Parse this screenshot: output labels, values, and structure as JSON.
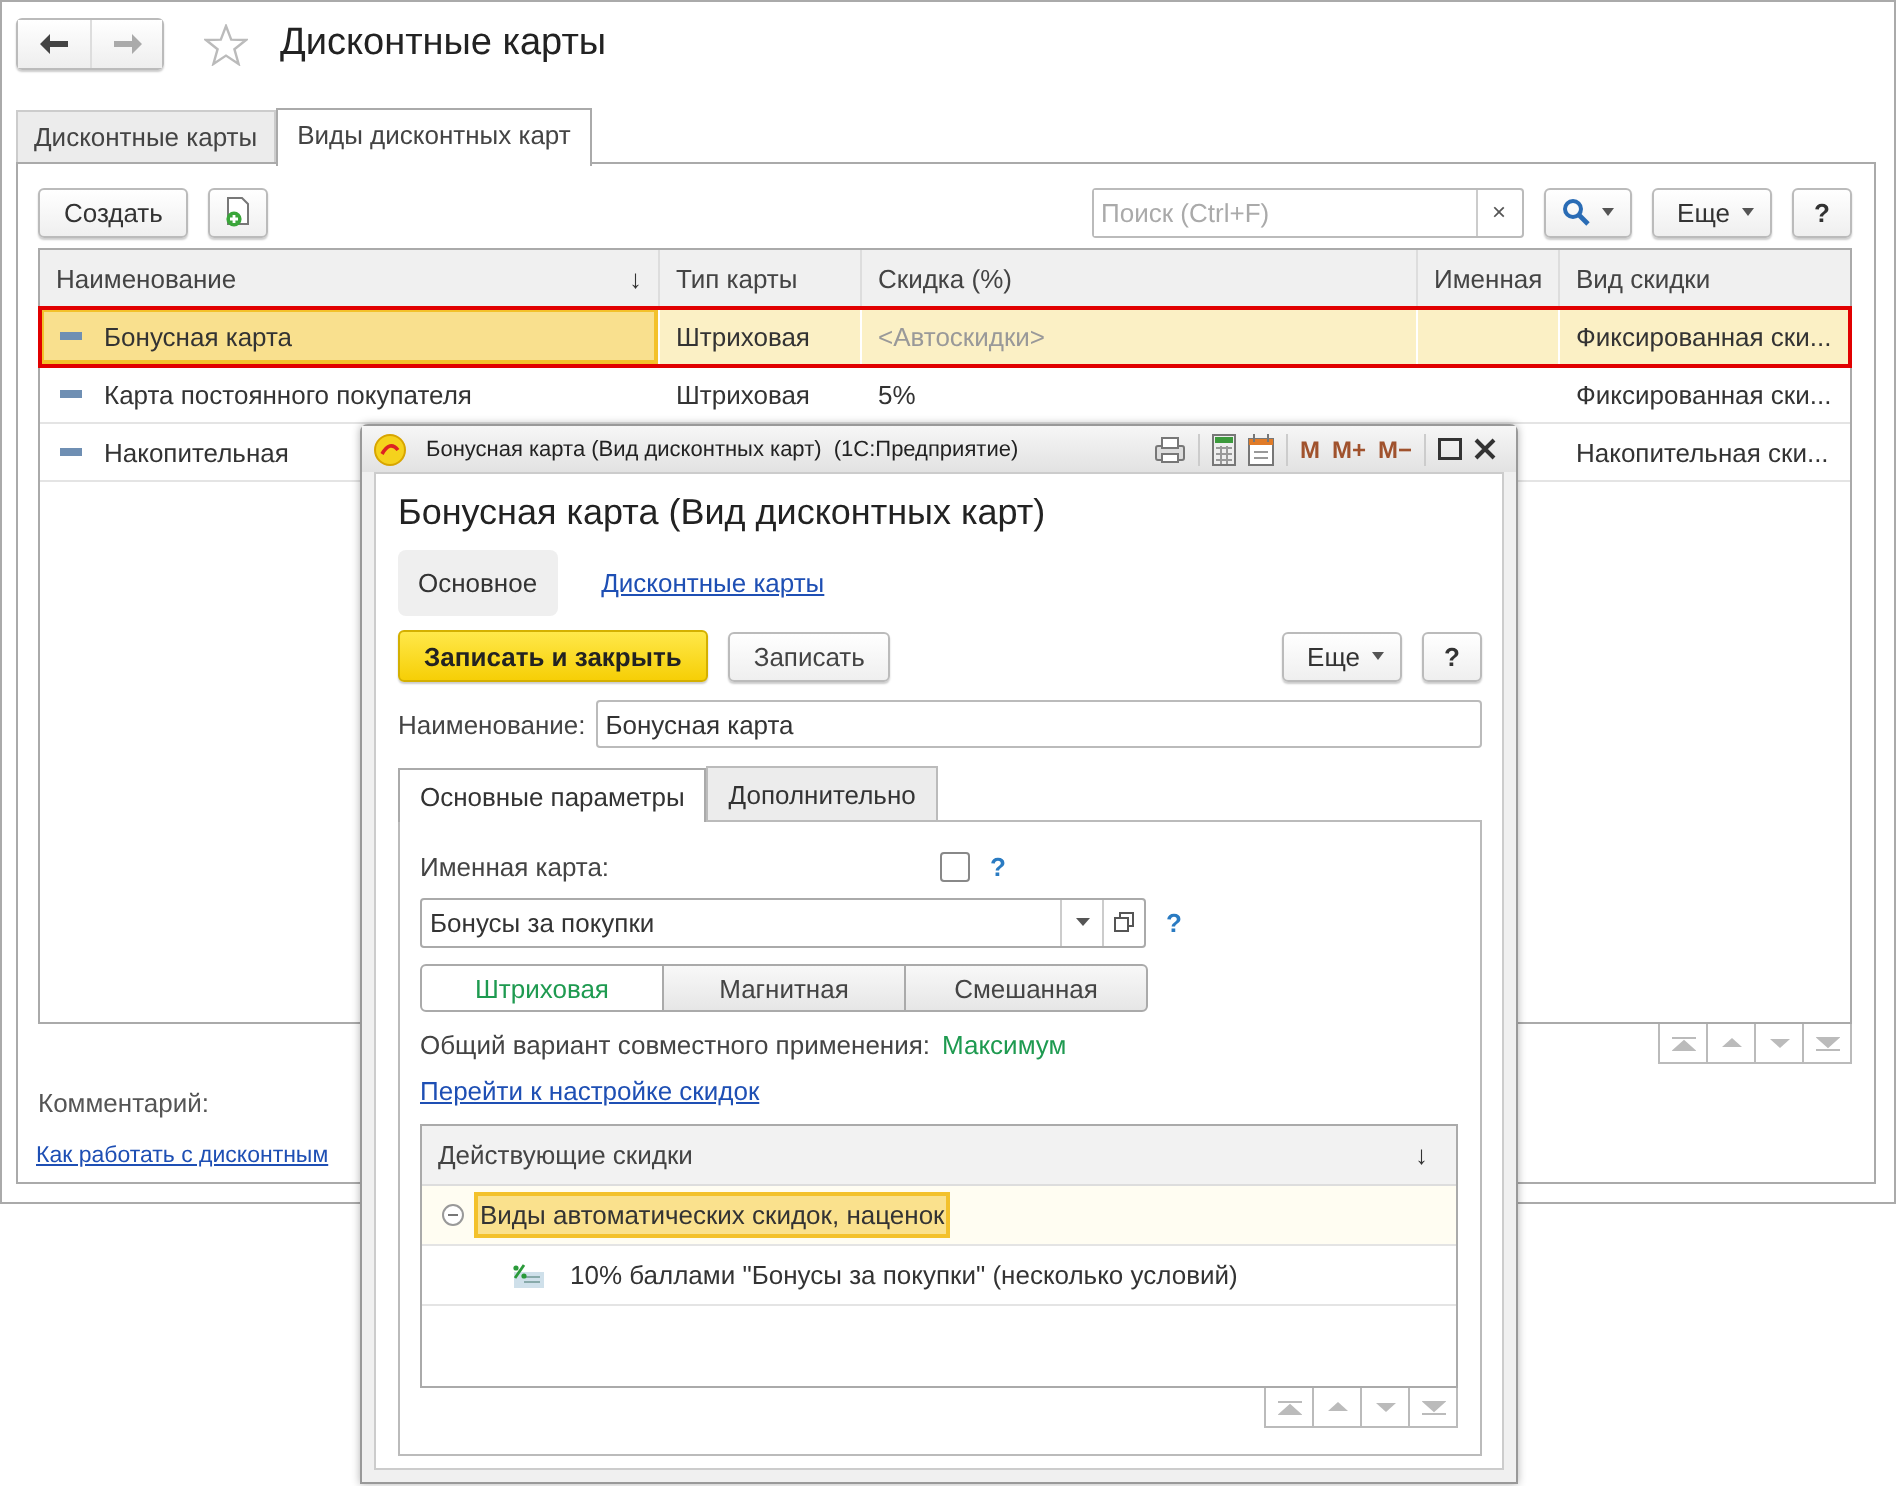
{
  "main_window": {
    "title": "Дисконтные карты",
    "tabs": [
      {
        "label": "Дисконтные карты",
        "selected": false
      },
      {
        "label": "Виды дисконтных карт",
        "selected": true
      }
    ],
    "toolbar": {
      "create": "Создать",
      "search_placeholder": "Поиск (Ctrl+F)",
      "clear": "×",
      "more": "Еще",
      "help": "?"
    },
    "table": {
      "columns": [
        {
          "label": "Наименование",
          "sort": "↓"
        },
        {
          "label": "Тип карты"
        },
        {
          "label": "Скидка (%)"
        },
        {
          "label": "Именная"
        },
        {
          "label": "Вид скидки"
        }
      ],
      "rows": [
        {
          "name": "Бонусная карта",
          "card_type": "Штриховая",
          "discount": "<Автоскидки>",
          "discount_auto": true,
          "discount_kind": "Фиксированная ски...",
          "selected": true
        },
        {
          "name": "Карта постоянного покупателя",
          "card_type": "Штриховая",
          "discount": "5%",
          "discount_auto": false,
          "discount_kind": "Фиксированная ски...",
          "selected": false
        },
        {
          "name": "Накопительная",
          "discount_kind": "Накопительная ски...",
          "selected": false
        }
      ]
    },
    "comment_label": "Комментарий:",
    "help_link": "Как работать с дисконтным"
  },
  "dialog": {
    "window_title": "Бонусная карта (Вид дисконтных карт)  (1С:Предприятие)",
    "memory_buttons": [
      "M",
      "M+",
      "M−"
    ],
    "heading": "Бонусная карта (Вид дисконтных карт)",
    "sections": [
      {
        "label": "Основное",
        "selected": true
      },
      {
        "label": "Дисконтные карты",
        "selected": false
      }
    ],
    "commands": {
      "save_close": "Записать и закрыть",
      "save": "Записать",
      "more": "Еще",
      "help": "?"
    },
    "name_label": "Наименование:",
    "name_value": "Бонусная карта",
    "tabs": [
      {
        "label": "Основные параметры",
        "selected": true
      },
      {
        "label": "Дополнительно",
        "selected": false
      }
    ],
    "personal_label": "Именная карта:",
    "personal_checked": false,
    "personal_hint": "?",
    "bonus_program": "Бонусы за покупки",
    "program_hint": "?",
    "card_types": [
      {
        "label": "Штриховая",
        "selected": true
      },
      {
        "label": "Магнитная",
        "selected": false
      },
      {
        "label": "Смешанная",
        "selected": false
      }
    ],
    "combine_label": "Общий вариант совместного применения:",
    "combine_value": "Максимум",
    "settings_link": "Перейти к настройке скидок",
    "discounts": {
      "column": "Действующие скидки",
      "sort": "↓",
      "items": [
        {
          "label": "Виды автоматических скидок, наценок",
          "expanded": true,
          "selected": true,
          "children": [
            {
              "label": "10% баллами \"Бонусы за покупки\" (несколько условий)",
              "selected": false
            }
          ]
        }
      ]
    }
  }
}
